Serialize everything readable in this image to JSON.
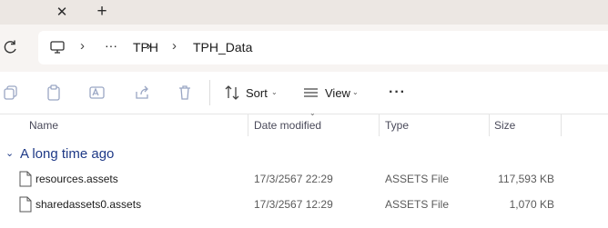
{
  "tabs": {
    "close_symbol": "✕",
    "new_tab_symbol": "+"
  },
  "address_bar": {
    "ellipsis": "···",
    "crumbs": [
      "TPH",
      "TPH_Data"
    ]
  },
  "toolbar": {
    "sort_label": "Sort",
    "view_label": "View",
    "more_symbol": "···"
  },
  "columns": {
    "name": "Name",
    "date_modified": "Date modified",
    "type": "Type",
    "size": "Size"
  },
  "group": {
    "label": "A long time ago"
  },
  "files": [
    {
      "name": "resources.assets",
      "date": "17/3/2567 22:29",
      "type": "ASSETS File",
      "size": "117,593 KB"
    },
    {
      "name": "sharedassets0.assets",
      "date": "17/3/2567 12:29",
      "type": "ASSETS File",
      "size": "1,070 KB"
    }
  ],
  "colors": {
    "titlebar": "#ece7e3",
    "addressrow": "#f7f4f2",
    "group_label": "#1f3a87"
  }
}
